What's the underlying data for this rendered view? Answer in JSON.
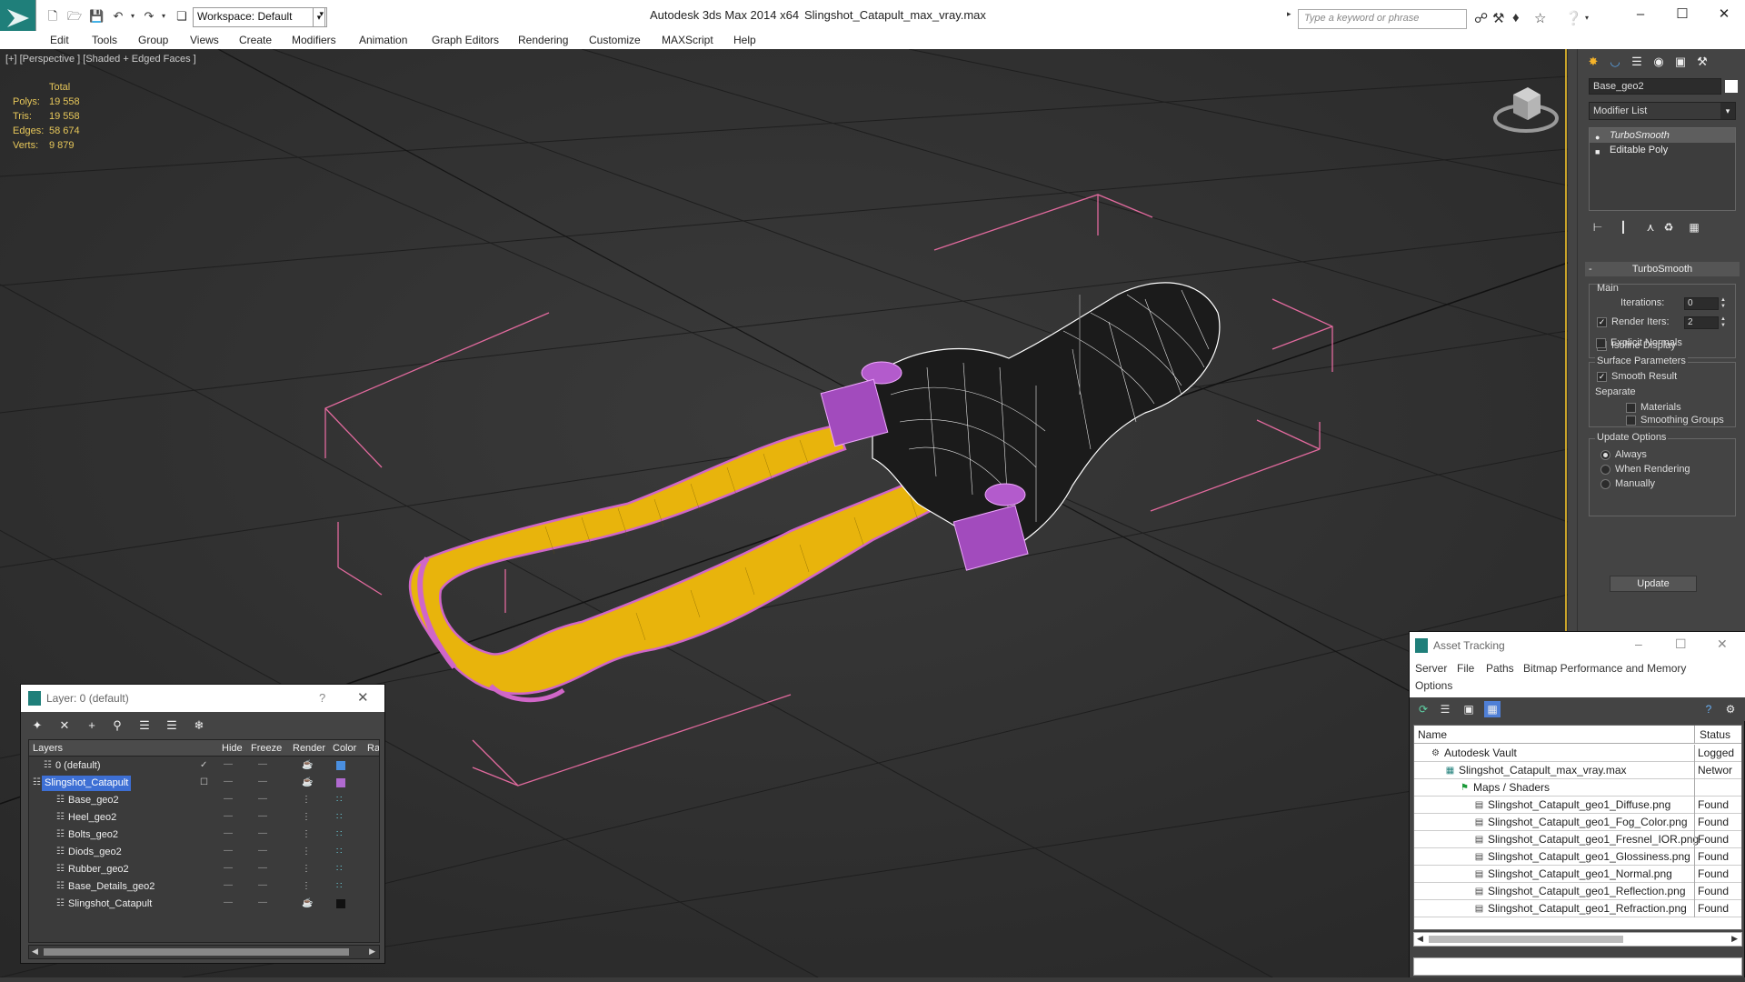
{
  "titlebar": {
    "workspace": "Workspace: Default",
    "app_title": "Autodesk 3ds Max  2014 x64",
    "file_name": "Slingshot_Catapult_max_vray.max",
    "search_placeholder": "Type a keyword or phrase"
  },
  "menu": [
    "Edit",
    "Tools",
    "Group",
    "Views",
    "Create",
    "Modifiers",
    "Animation",
    "Graph Editors",
    "Rendering",
    "Customize",
    "MAXScript",
    "Help"
  ],
  "viewport": {
    "label": "[+] [Perspective ] [Shaded + Edged Faces ]",
    "stats": {
      "total_label": "Total",
      "rows": [
        {
          "label": "Polys:",
          "value": "19 558"
        },
        {
          "label": "Tris:",
          "value": "19 558"
        },
        {
          "label": "Edges:",
          "value": "58 674"
        },
        {
          "label": "Verts:",
          "value": "9 879"
        }
      ]
    }
  },
  "command_panel": {
    "object_name": "Base_geo2",
    "modifier_list": "Modifier List",
    "stack": [
      {
        "label": "TurboSmooth",
        "selected": true
      },
      {
        "label": "Editable Poly",
        "selected": false
      }
    ],
    "turbosmooth": {
      "header": "TurboSmooth",
      "main_title": "Main",
      "iterations_label": "Iterations:",
      "iterations_value": "0",
      "render_iters_label": "Render Iters:",
      "render_iters_value": "2",
      "isoline_label": "Isoline Display",
      "explicit_normals_label": "Explicit Normals",
      "surface_title": "Surface Parameters",
      "smooth_result_label": "Smooth Result",
      "separate_label": "Separate",
      "materials_label": "Materials",
      "smoothing_groups_label": "Smoothing Groups",
      "update_title": "Update Options",
      "always_label": "Always",
      "when_rendering_label": "When Rendering",
      "manually_label": "Manually",
      "update_button": "Update"
    }
  },
  "layer_dialog": {
    "title": "Layer: 0 (default)",
    "help": "?",
    "columns": {
      "layers": "Layers",
      "hide": "Hide",
      "freeze": "Freeze",
      "render": "Render",
      "color": "Color",
      "ra": "Ra"
    },
    "rows": [
      {
        "name": "0 (default)",
        "indent": 1,
        "color": "#4a8fe0",
        "selected": false
      },
      {
        "name": "Slingshot_Catapult",
        "indent": 0,
        "color": "#b06ad0",
        "selected": true
      },
      {
        "name": "Base_geo2",
        "indent": 2,
        "color": "",
        "selected": false
      },
      {
        "name": "Heel_geo2",
        "indent": 2,
        "color": "",
        "selected": false
      },
      {
        "name": "Bolts_geo2",
        "indent": 2,
        "color": "",
        "selected": false
      },
      {
        "name": "Diods_geo2",
        "indent": 2,
        "color": "",
        "selected": false
      },
      {
        "name": "Rubber_geo2",
        "indent": 2,
        "color": "",
        "selected": false
      },
      {
        "name": "Base_Details_geo2",
        "indent": 2,
        "color": "",
        "selected": false
      },
      {
        "name": "Slingshot_Catapult",
        "indent": 2,
        "color": "#111111",
        "selected": false
      }
    ]
  },
  "asset_tracking": {
    "title": "Asset Tracking",
    "menu": [
      "Server",
      "File",
      "Paths",
      "Bitmap Performance and Memory",
      "Options"
    ],
    "columns": {
      "name": "Name",
      "status": "Status"
    },
    "rows": [
      {
        "name": "Autodesk Vault",
        "status": "Logged",
        "indent": 0
      },
      {
        "name": "Slingshot_Catapult_max_vray.max",
        "status": "Networ",
        "indent": 1
      },
      {
        "name": "Maps / Shaders",
        "status": "",
        "indent": 2
      },
      {
        "name": "Slingshot_Catapult_geo1_Diffuse.png",
        "status": "Found",
        "indent": 3
      },
      {
        "name": "Slingshot_Catapult_geo1_Fog_Color.png",
        "status": "Found",
        "indent": 3
      },
      {
        "name": "Slingshot_Catapult_geo1_Fresnel_IOR.png",
        "status": "Found",
        "indent": 3
      },
      {
        "name": "Slingshot_Catapult_geo1_Glossiness.png",
        "status": "Found",
        "indent": 3
      },
      {
        "name": "Slingshot_Catapult_geo1_Normal.png",
        "status": "Found",
        "indent": 3
      },
      {
        "name": "Slingshot_Catapult_geo1_Reflection.png",
        "status": "Found",
        "indent": 3
      },
      {
        "name": "Slingshot_Catapult_geo1_Refraction.png",
        "status": "Found",
        "indent": 3
      }
    ]
  }
}
